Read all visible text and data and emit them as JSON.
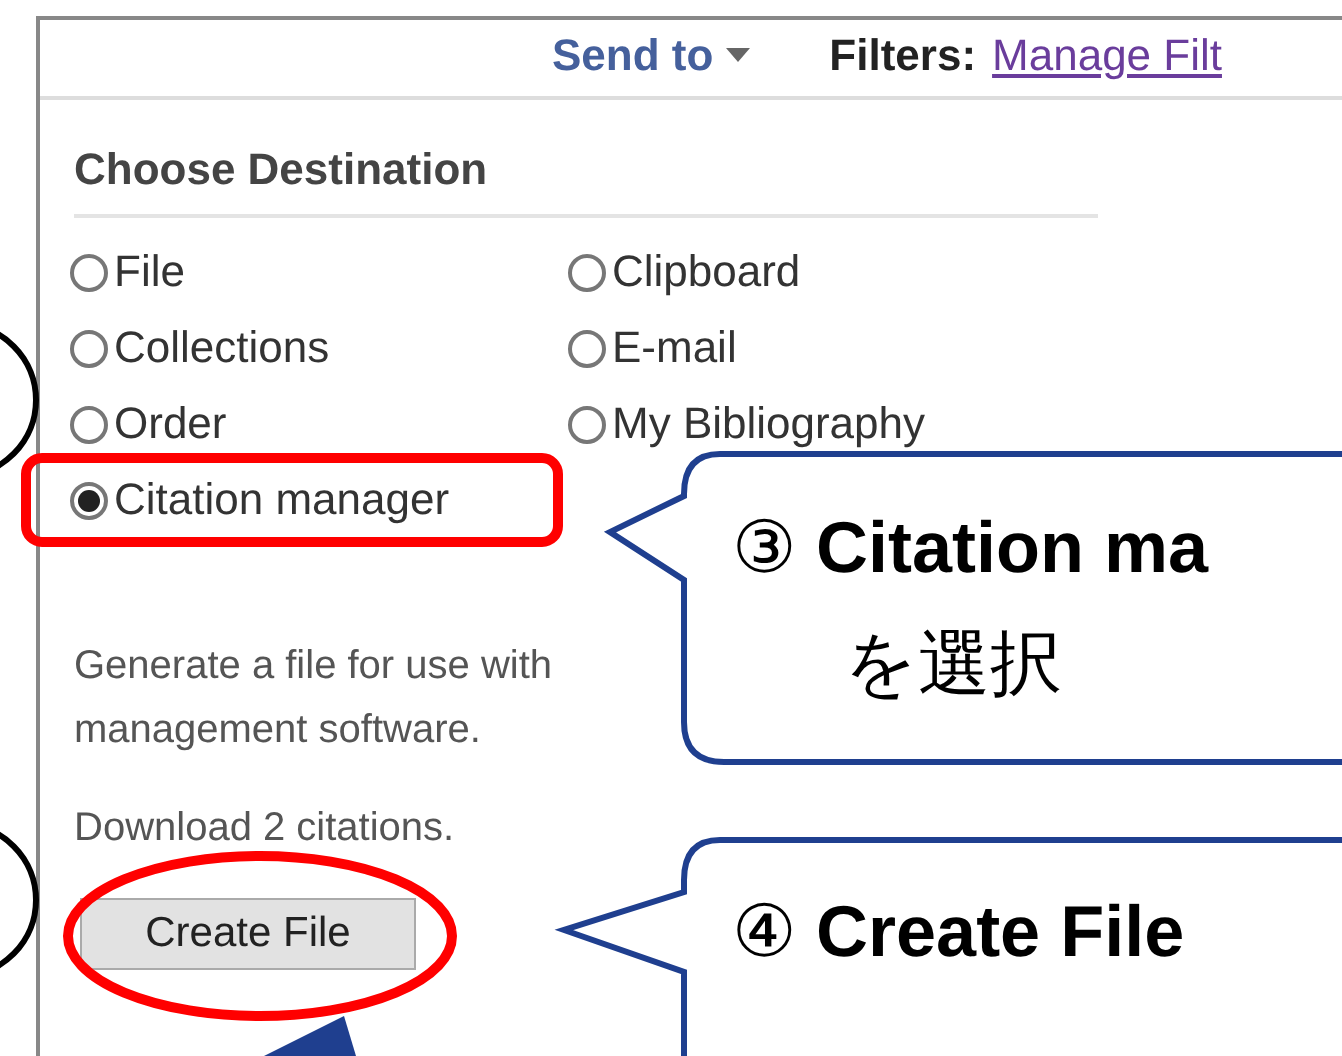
{
  "header": {
    "send_to": "Send to",
    "filters_label": "Filters:",
    "filters_link": "Manage Filt"
  },
  "destination": {
    "title": "Choose Destination",
    "options": [
      {
        "label": "File",
        "selected": false
      },
      {
        "label": "Clipboard",
        "selected": false
      },
      {
        "label": "Collections",
        "selected": false
      },
      {
        "label": "E-mail",
        "selected": false
      },
      {
        "label": "Order",
        "selected": false
      },
      {
        "label": "My Bibliography",
        "selected": false
      },
      {
        "label": "Citation manager",
        "selected": true
      }
    ],
    "description": "Generate a file for use with management software.",
    "download_note": "Download 2 citations.",
    "button": "Create File"
  },
  "callouts": [
    {
      "number": "③",
      "title": "Citation ma",
      "text": "を選択"
    },
    {
      "number": "④",
      "title": "Create File"
    }
  ]
}
